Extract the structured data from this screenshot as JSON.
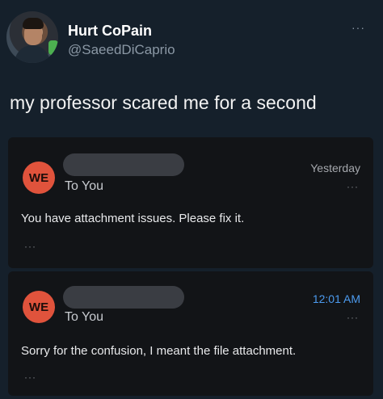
{
  "tweet": {
    "display_name": "Hurt CoPain",
    "handle": "@SaeedDiCaprio",
    "more": "···",
    "text": "my professor scared me for a second"
  },
  "emails": [
    {
      "initials": "WE",
      "to": "To You",
      "time": "Yesterday",
      "more": "···",
      "body": "You have attachment issues. Please fix it.",
      "expand": "···"
    },
    {
      "initials": "WE",
      "to": "To You",
      "time": "12:01 AM",
      "more": "···",
      "body": "Sorry for the confusion, I meant the file attachment.",
      "expand": "···"
    }
  ],
  "colors": {
    "background": "#15202b",
    "card": "#121417",
    "badge": "#e0533c",
    "time_highlight": "#4c9bef"
  }
}
